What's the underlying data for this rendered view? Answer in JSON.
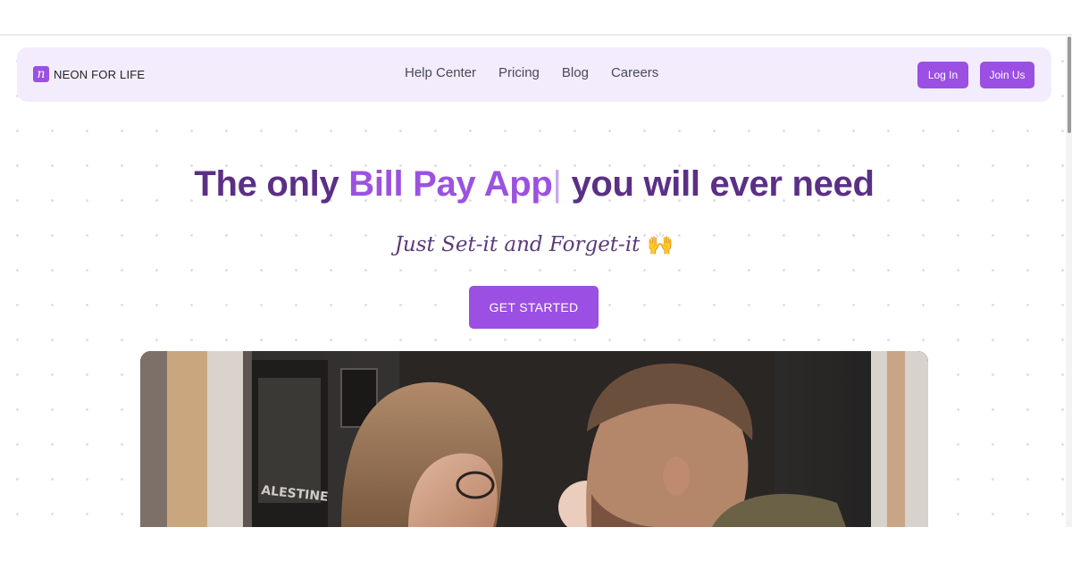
{
  "brand": {
    "logo_letter": "n",
    "name": "NEON FOR LIFE"
  },
  "nav": {
    "links": [
      "Help Center",
      "Pricing",
      "Blog",
      "Careers"
    ]
  },
  "auth": {
    "login_label": "Log In",
    "join_label": "Join Us"
  },
  "hero": {
    "headline_pre": "The only ",
    "headline_accent": "Bill Pay App",
    "headline_cursor": "|",
    "headline_post": " you will ever need",
    "subline": "Just Set-it and Forget-it",
    "emoji": "🙌",
    "cta_label": "GET STARTED"
  },
  "colors": {
    "accent": "#9b4fe3",
    "heading": "#5b2f86",
    "nav_bg": "#f3ecfd"
  },
  "icons": {
    "brand": "brand-logo-icon",
    "emoji": "raising-hands-emoji-icon"
  }
}
